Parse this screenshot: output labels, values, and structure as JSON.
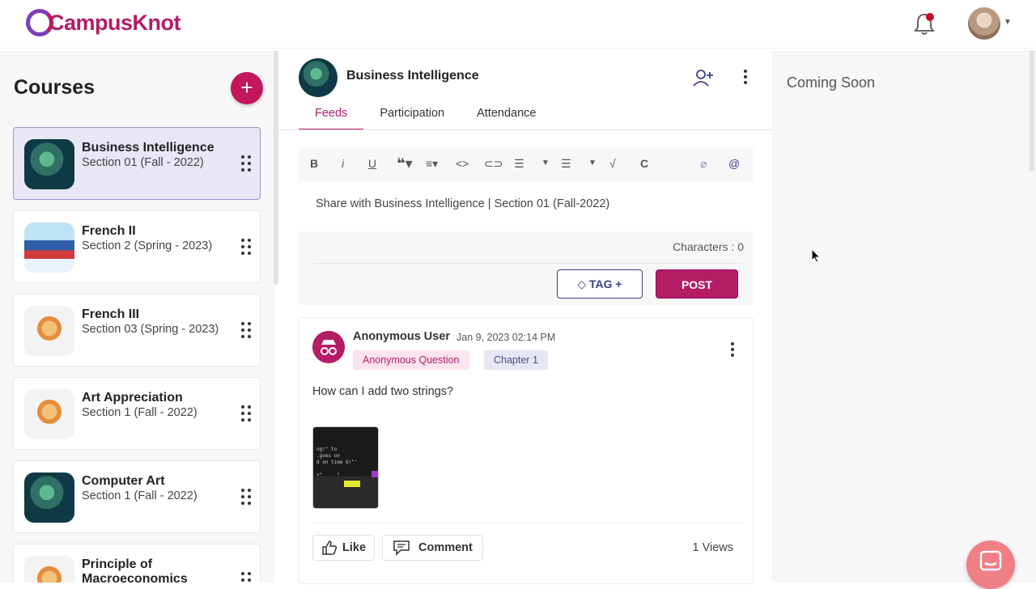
{
  "header": {
    "logo_text": "CampusKnot",
    "icons": {
      "notifications": "bell-icon",
      "profile": "user-avatar"
    }
  },
  "sidebar": {
    "title": "Courses",
    "add_icon": "plus-icon",
    "courses": [
      {
        "name": "Business Intelligence",
        "section": "Section 01 (Fall - 2022)",
        "active": true,
        "thumb": "globe"
      },
      {
        "name": "French II",
        "section": "Section 2 (Spring - 2023)",
        "active": false,
        "thumb": "books"
      },
      {
        "name": "French III",
        "section": "Section 03 (Spring - 2023)",
        "active": false,
        "thumb": "art"
      },
      {
        "name": "Art Appreciation",
        "section": "Section 1 (Fall - 2022)",
        "active": false,
        "thumb": "art"
      },
      {
        "name": "Computer Art",
        "section": "Section 1 (Fall - 2022)",
        "active": false,
        "thumb": "globe"
      },
      {
        "name": "Principle of Macroeconomics",
        "section": "",
        "active": false,
        "thumb": "art"
      }
    ]
  },
  "course_header": {
    "title": "Business Intelligence",
    "tabs": [
      {
        "label": "Feeds",
        "active": true
      },
      {
        "label": "Participation",
        "active": false
      },
      {
        "label": "Attendance",
        "active": false
      }
    ]
  },
  "composer": {
    "toolbar": [
      "B",
      "i",
      "U",
      "quote",
      "align",
      "code",
      "link",
      "ordered-list",
      "bullet-list",
      "check",
      "C",
      "attach",
      "mention"
    ],
    "placeholder": "Share with Business Intelligence | Section 01 (Fall-2022)",
    "characters_label": "Characters : 0",
    "tag_button": "TAG +",
    "post_button": "POST"
  },
  "post": {
    "author": "Anonymous User",
    "timestamp": "Jan 9, 2023 02:14 PM",
    "badges": [
      "Anonymous Question",
      "Chapter 1"
    ],
    "question": "How can I add two strings?",
    "like_label": "Like",
    "comment_label": "Comment",
    "views_label": "1 Views"
  },
  "right_panel": {
    "coming_soon": "Coming Soon"
  },
  "colors": {
    "brand": "#b41c66",
    "accent_blue": "#3b3f8c",
    "chat_button": "#f07f86"
  }
}
